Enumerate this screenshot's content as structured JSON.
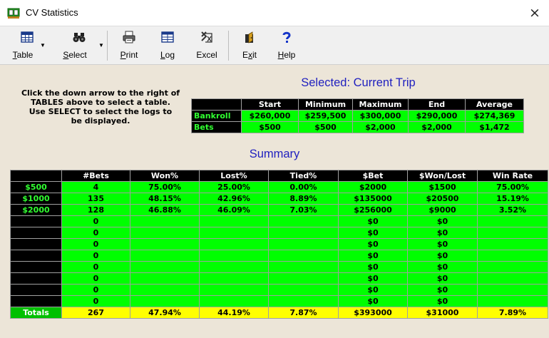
{
  "window": {
    "title": "CV Statistics",
    "close_glyph": "×",
    "icon": "green-cards-icon"
  },
  "toolbar": {
    "table": {
      "label_u": "T",
      "label_rest": "able",
      "icon": "table-icon"
    },
    "select": {
      "label_u": "S",
      "label_rest": "elect",
      "icon": "binoculars-icon"
    },
    "print": {
      "label_u": "P",
      "label_rest": "rint",
      "icon": "printer-icon"
    },
    "log": {
      "label_u": "L",
      "label_rest": "og",
      "icon": "log-grid-icon"
    },
    "excel": {
      "label": "Excel",
      "icon": "excel-icon"
    },
    "exit": {
      "label_pre": "E",
      "label_u": "x",
      "label_rest": "it",
      "icon": "exit-door-icon"
    },
    "help": {
      "label_u": "H",
      "label_rest": "elp",
      "icon": "help-question-icon"
    }
  },
  "instructions": {
    "line1": "Click the down arrow to the right of",
    "line2": "TABLES above to select a table.",
    "line3": "Use SELECT to select the logs to",
    "line4": "be displayed."
  },
  "selected_title": "Selected: Current Trip",
  "trip": {
    "headers": [
      "Start",
      "Minimum",
      "Maximum",
      "End",
      "Average"
    ],
    "rows": [
      {
        "label": "Bankroll",
        "values": [
          "$260,000",
          "$259,500",
          "$300,000",
          "$290,000",
          "$274,369"
        ]
      },
      {
        "label": "Bets",
        "values": [
          "$500",
          "$500",
          "$2,000",
          "$2,000",
          "$1,472"
        ]
      }
    ]
  },
  "summary_title": "Summary",
  "summary": {
    "headers": [
      "",
      "#Bets",
      "Won%",
      "Lost%",
      "Tied%",
      "$Bet",
      "$Won/Lost",
      "Win Rate"
    ],
    "rows": [
      [
        "$500",
        "4",
        "75.00%",
        "25.00%",
        "0.00%",
        "$2000",
        "$1500",
        "75.00%"
      ],
      [
        "$1000",
        "135",
        "48.15%",
        "42.96%",
        "8.89%",
        "$135000",
        "$20500",
        "15.19%"
      ],
      [
        "$2000",
        "128",
        "46.88%",
        "46.09%",
        "7.03%",
        "$256000",
        "$9000",
        "3.52%"
      ],
      [
        "",
        "0",
        "",
        "",
        "",
        "$0",
        "$0",
        ""
      ],
      [
        "",
        "0",
        "",
        "",
        "",
        "$0",
        "$0",
        ""
      ],
      [
        "",
        "0",
        "",
        "",
        "",
        "$0",
        "$0",
        ""
      ],
      [
        "",
        "0",
        "",
        "",
        "",
        "$0",
        "$0",
        ""
      ],
      [
        "",
        "0",
        "",
        "",
        "",
        "$0",
        "$0",
        ""
      ],
      [
        "",
        "0",
        "",
        "",
        "",
        "$0",
        "$0",
        ""
      ],
      [
        "",
        "0",
        "",
        "",
        "",
        "$0",
        "$0",
        ""
      ],
      [
        "",
        "0",
        "",
        "",
        "",
        "$0",
        "$0",
        ""
      ]
    ],
    "totals": [
      "Totals",
      "267",
      "47.94%",
      "44.19%",
      "7.87%",
      "$393000",
      "$31000",
      "7.89%"
    ]
  }
}
